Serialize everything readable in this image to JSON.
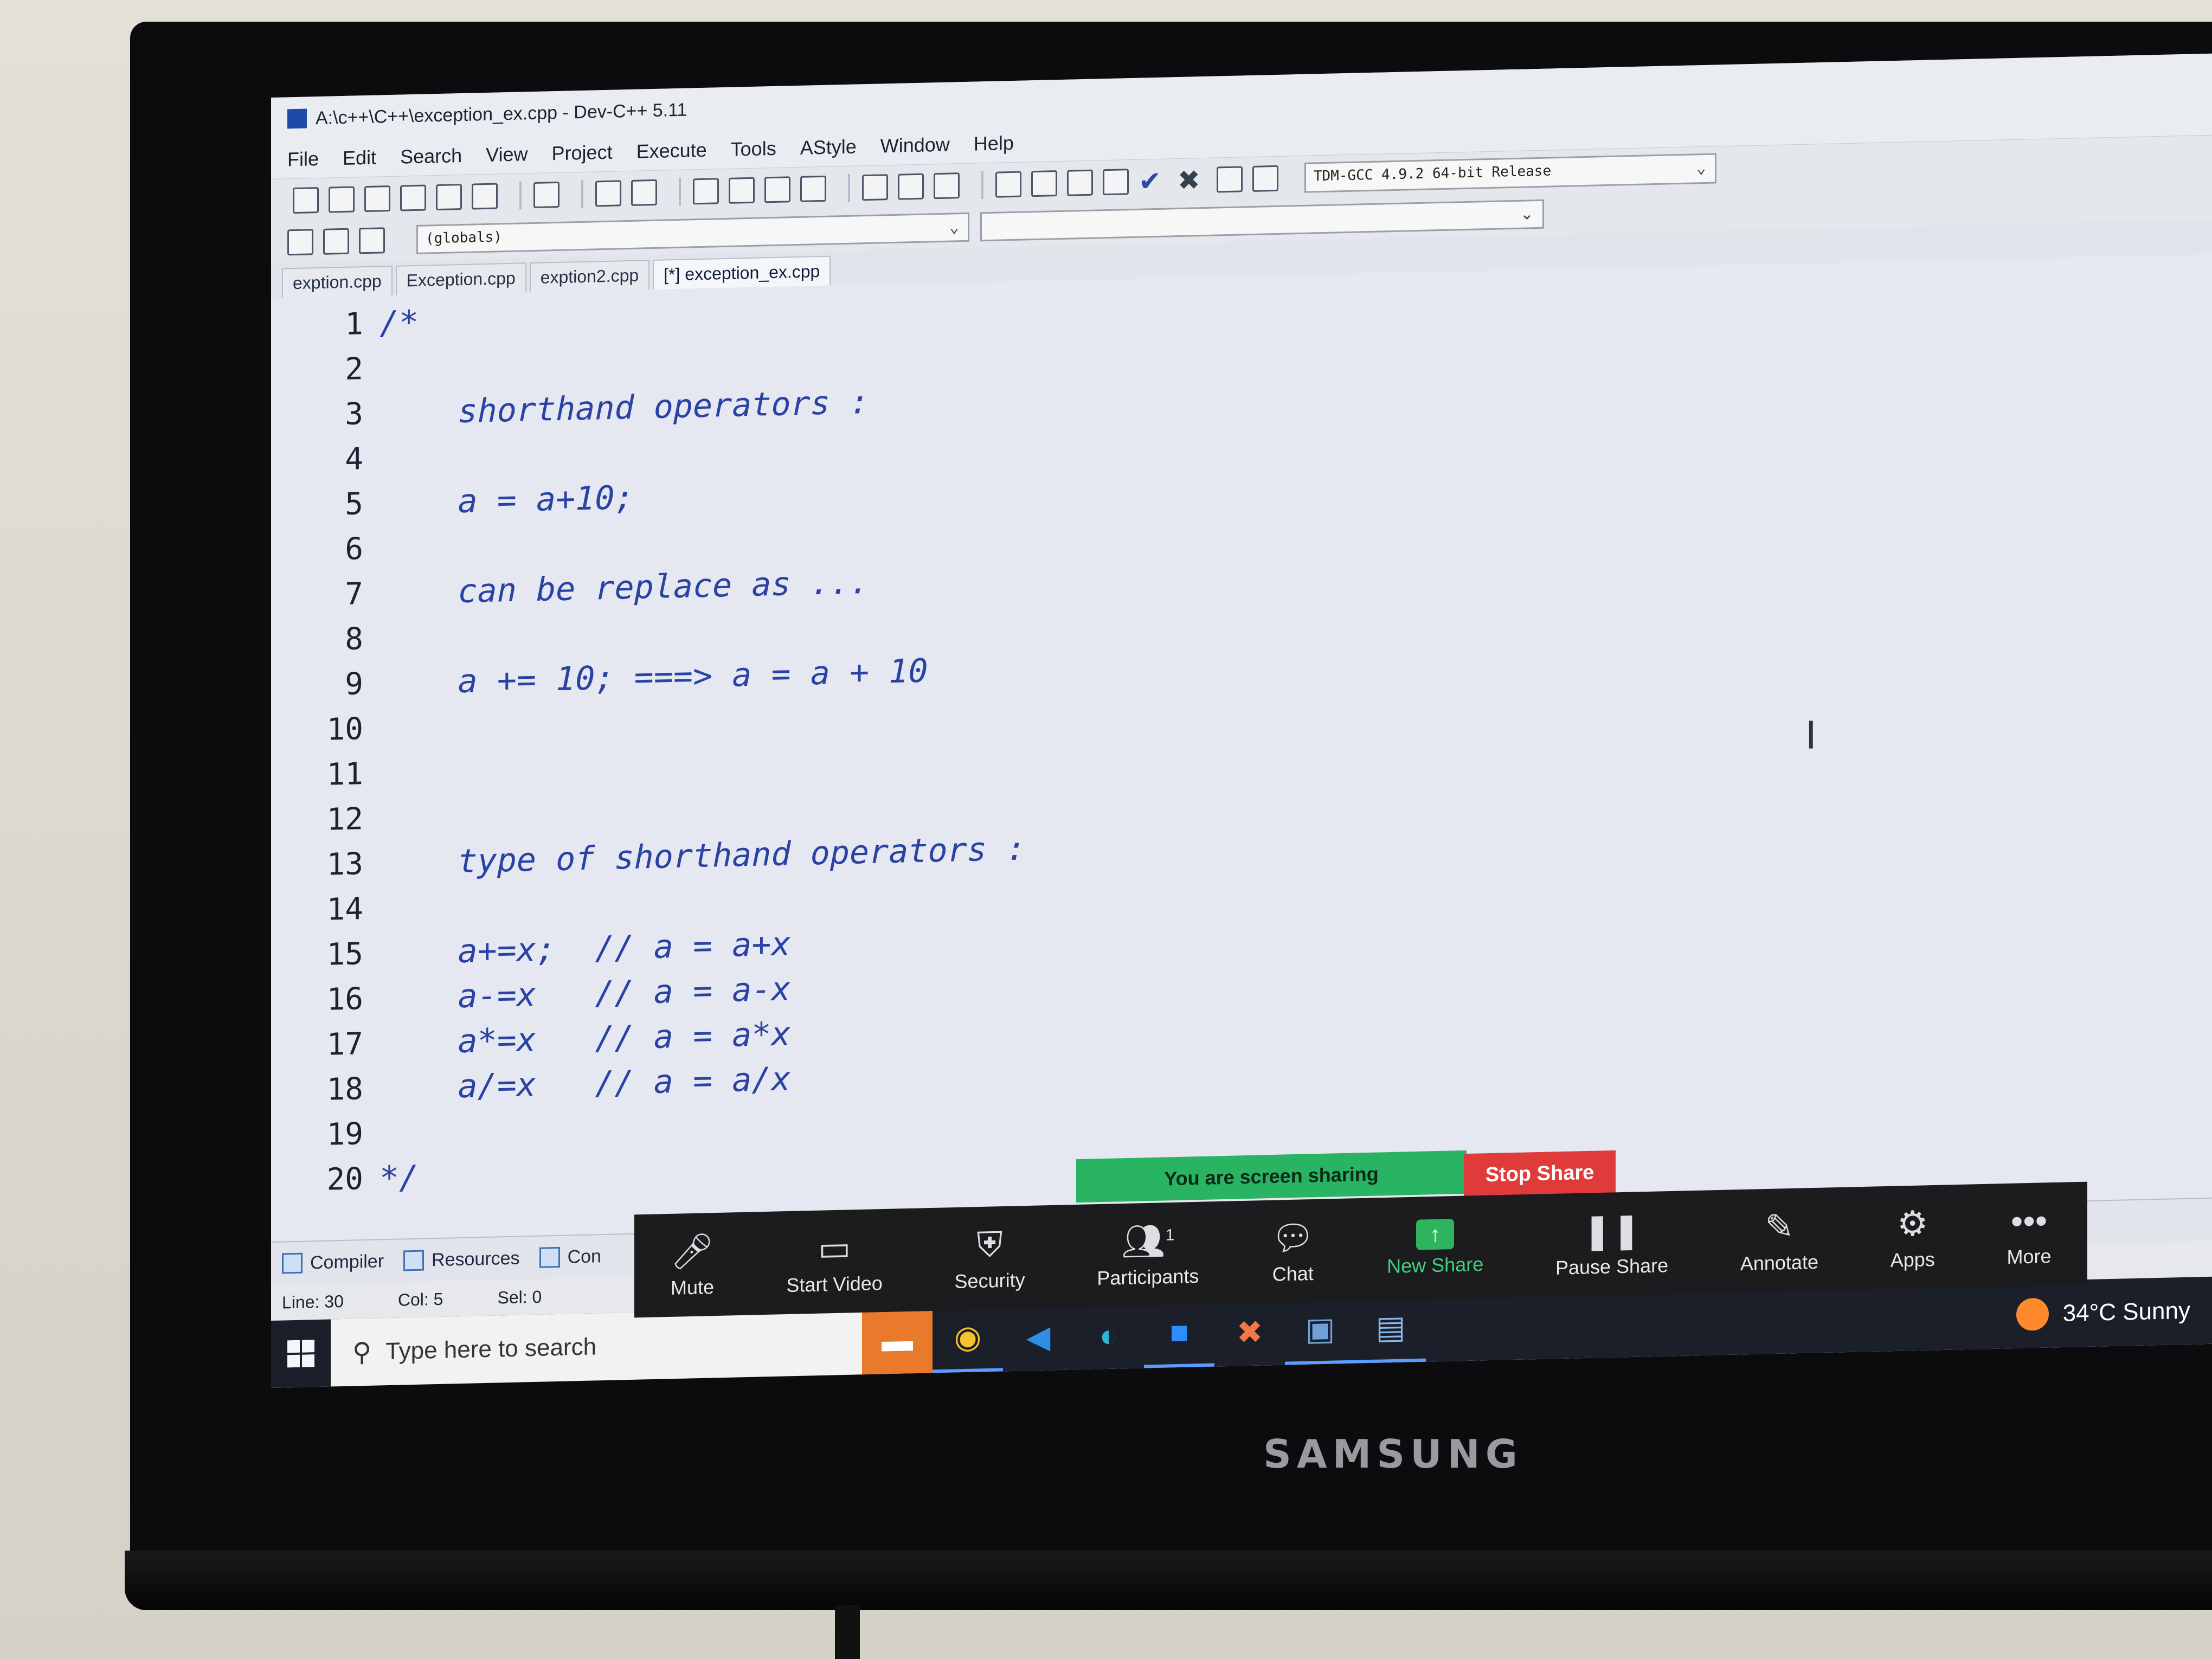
{
  "window": {
    "title": "A:\\c++\\C++\\exception_ex.cpp - Dev-C++ 5.11"
  },
  "menu": [
    "File",
    "Edit",
    "Search",
    "View",
    "Project",
    "Execute",
    "Tools",
    "AStyle",
    "Window",
    "Help"
  ],
  "toolbar": {
    "compiler_select": "TDM-GCC 4.9.2 64-bit Release",
    "globals_select": "(globals)"
  },
  "tabs": [
    {
      "label": "exption.cpp"
    },
    {
      "label": "Exception.cpp"
    },
    {
      "label": "exption2.cpp"
    },
    {
      "label": "[*] exception_ex.cpp"
    }
  ],
  "editor": {
    "line_numbers": [
      "1",
      "2",
      "3",
      "4",
      "5",
      "6",
      "7",
      "8",
      "9",
      "10",
      "11",
      "12",
      "13",
      "14",
      "15",
      "16",
      "17",
      "18",
      "19",
      "20"
    ],
    "lines": [
      "/*",
      "",
      "    shorthand operators :",
      "",
      "    a = a+10;",
      "",
      "    can be replace as ...",
      "",
      "    a += 10; ===> a = a + 10",
      "",
      "",
      "",
      "    type of shorthand operators :",
      "",
      "    a+=x;  // a = a+x",
      "    a-=x   // a = a-x",
      "    a*=x   // a = a*x",
      "    a/=x   // a = a/x",
      "",
      "*/"
    ]
  },
  "bottom_tabs": {
    "compiler": "Compiler",
    "resources": "Resources",
    "compile_log": "Con"
  },
  "status": {
    "line": "Line: 30",
    "col": "Col: 5",
    "sel": "Sel: 0"
  },
  "taskbar": {
    "search_placeholder": "Type here to search",
    "weather": "34°C  Sunny"
  },
  "zoom": {
    "banner": "You are screen sharing",
    "stop_share": "Stop Share",
    "participants_count": "1",
    "buttons": {
      "mute": "Mute",
      "start_video": "Start Video",
      "security": "Security",
      "participants": "Participants",
      "chat": "Chat",
      "new_share": "New Share",
      "pause_share": "Pause Share",
      "annotate": "Annotate",
      "apps": "Apps",
      "more": "More"
    }
  },
  "monitor": {
    "brand": "SAMSUNG"
  }
}
